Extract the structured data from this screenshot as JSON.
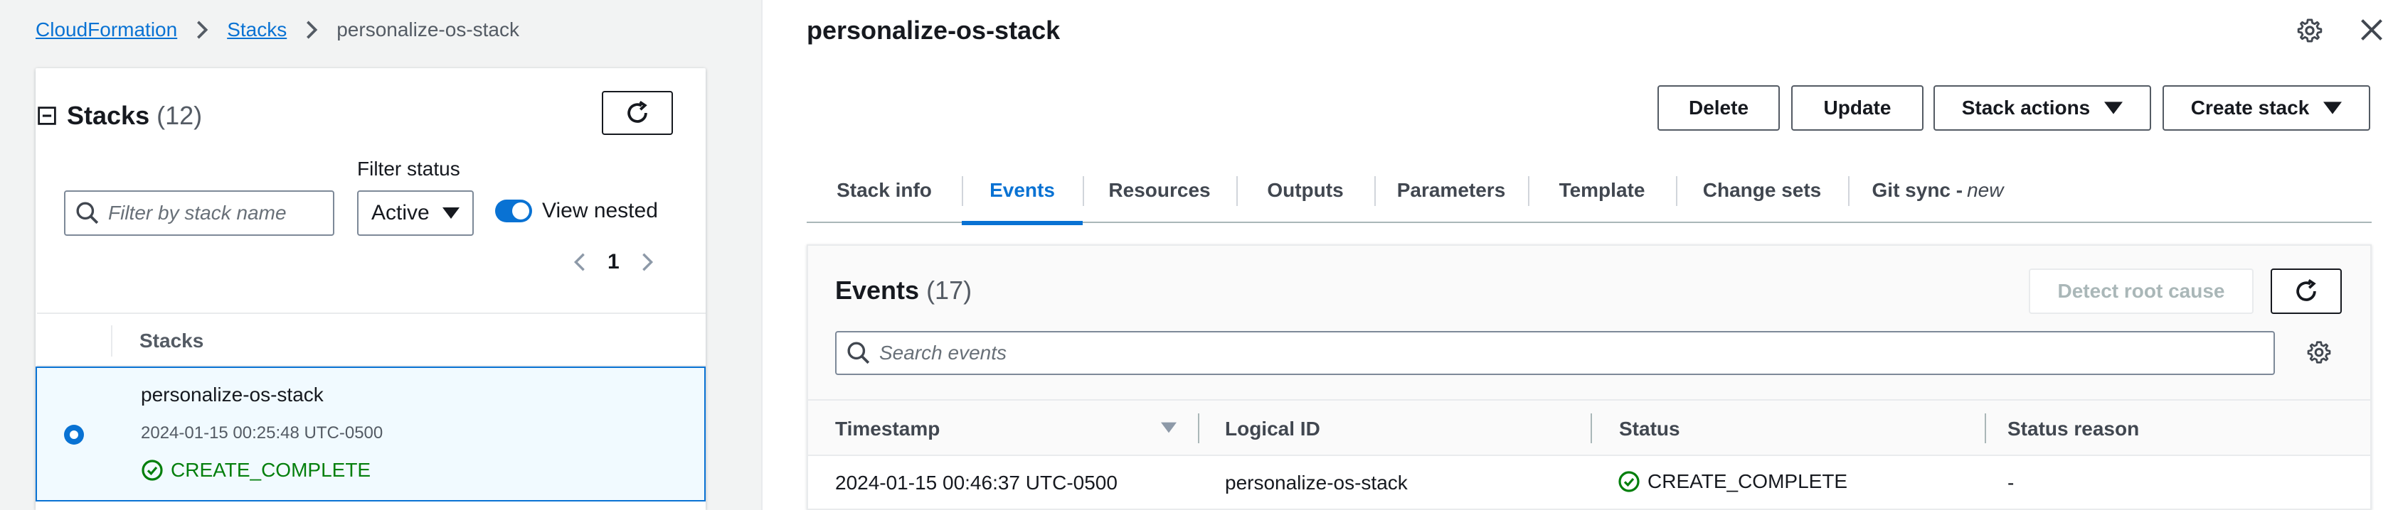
{
  "breadcrumb": {
    "root": "CloudFormation",
    "stacks": "Stacks",
    "current": "personalize-os-stack"
  },
  "stacks_panel": {
    "title": "Stacks",
    "count": "(12)",
    "filter_status_label": "Filter status",
    "search_placeholder": "Filter by stack name",
    "status_selected": "Active",
    "view_nested_label": "View nested",
    "view_nested_on": true,
    "page": "1",
    "column_header": "Stacks",
    "rows": [
      {
        "name": "personalize-os-stack",
        "created": "2024-01-15 00:25:48 UTC-0500",
        "status": "CREATE_COMPLETE",
        "selected": true
      }
    ]
  },
  "detail": {
    "title": "personalize-os-stack",
    "buttons": {
      "delete": "Delete",
      "update": "Update",
      "stack_actions": "Stack actions",
      "create_stack": "Create stack"
    },
    "tabs": [
      {
        "label": "Stack info"
      },
      {
        "label": "Events",
        "active": true
      },
      {
        "label": "Resources"
      },
      {
        "label": "Outputs"
      },
      {
        "label": "Parameters"
      },
      {
        "label": "Template"
      },
      {
        "label": "Change sets"
      },
      {
        "label": "Git sync - ",
        "suffix": "new"
      }
    ],
    "events": {
      "title": "Events",
      "count": "(17)",
      "detect_root_cause": "Detect root cause",
      "search_placeholder": "Search events",
      "columns": [
        "Timestamp",
        "Logical ID",
        "Status",
        "Status reason"
      ],
      "rows": [
        {
          "timestamp": "2024-01-15 00:46:37 UTC-0500",
          "logical_id": "personalize-os-stack",
          "status": "CREATE_COMPLETE",
          "reason": "-"
        }
      ]
    }
  },
  "icons": {
    "breadcrumb_separator": "chevron-right-icon",
    "refresh": "refresh-icon",
    "search": "search-icon",
    "settings": "gear-icon",
    "close": "close-icon",
    "success": "check-circle-icon"
  },
  "colors": {
    "link": "#0972d3",
    "success": "#037f0c",
    "selected_row_bg": "#f1faff",
    "panel_bg": "#f2f3f3"
  }
}
